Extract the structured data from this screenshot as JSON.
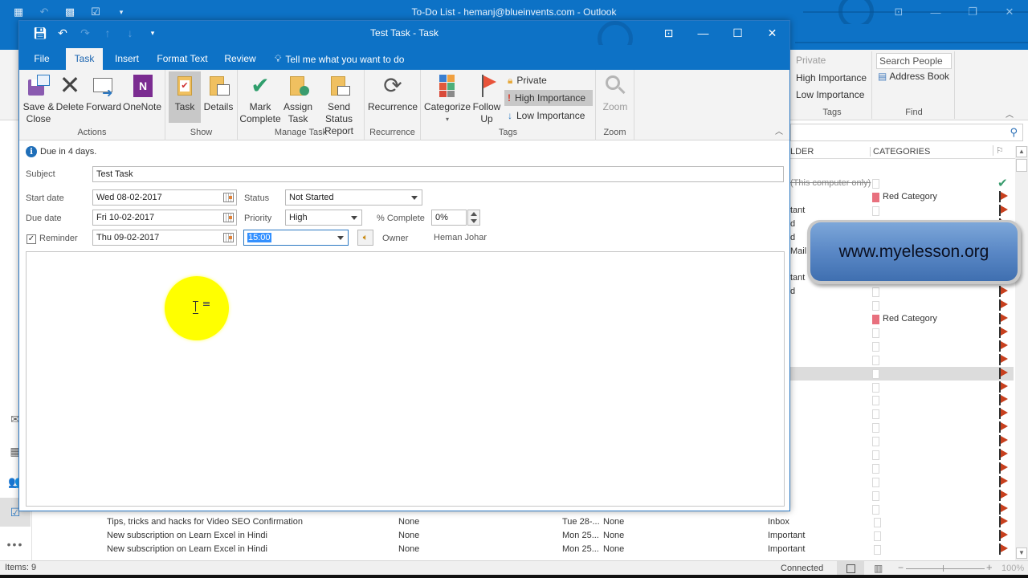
{
  "background_window": {
    "title": "To-Do List - hemanj@blueinvents.com  -  Outlook",
    "qat_icons": [
      "outlook-app-icon",
      "undo-icon",
      "address-book-icon",
      "task-icon",
      "customize-qat-icon"
    ],
    "window_controls": [
      "ribbon-display-icon",
      "minimize-icon",
      "restore-icon",
      "close-icon"
    ],
    "ribbon": {
      "tags": {
        "private": "Private",
        "high_importance": "High Importance",
        "low_importance": "Low Importance",
        "label": "Tags"
      },
      "find": {
        "search_people_placeholder": "Search People",
        "address_book": "Address Book",
        "label": "Find"
      }
    },
    "list": {
      "columns": {
        "folder": "LDER",
        "categories": "CATEGORIES"
      },
      "rows": [
        {
          "folder": "(This computer only)",
          "strike": true,
          "category": "",
          "flag": "complete"
        },
        {
          "folder": "",
          "category": "Red Category",
          "flag": "flag"
        },
        {
          "folder": "tant",
          "category": "",
          "flag": "flag"
        },
        {
          "folder": "d",
          "category": "",
          "flag": "flag"
        },
        {
          "folder": "d",
          "category": "",
          "flag": "flag"
        },
        {
          "folder": "Mail",
          "category": "",
          "flag": "flag"
        },
        {
          "folder": "",
          "category": "",
          "flag": "flag"
        },
        {
          "folder": "tant",
          "category": "",
          "flag": "flag"
        },
        {
          "folder": "d",
          "category": "",
          "flag": "flag"
        },
        {
          "folder": "",
          "category": "",
          "flag": "flag"
        },
        {
          "folder": "",
          "category": "Red Category",
          "flag": "flag"
        },
        {
          "folder": "",
          "category": "",
          "flag": "flag"
        },
        {
          "folder": "",
          "category": "",
          "flag": "flag"
        },
        {
          "folder": "",
          "category": "",
          "flag": "flag"
        },
        {
          "folder": "",
          "category": "",
          "flag": "flag",
          "selected": true
        },
        {
          "folder": "",
          "category": "",
          "flag": "flag"
        },
        {
          "folder": "",
          "category": "",
          "flag": "flag"
        },
        {
          "folder": "",
          "category": "",
          "flag": "flag"
        },
        {
          "folder": "",
          "category": "",
          "flag": "flag"
        },
        {
          "folder": "",
          "category": "",
          "flag": "flag"
        },
        {
          "folder": "",
          "category": "",
          "flag": "flag"
        },
        {
          "folder": "",
          "category": "",
          "flag": "flag"
        },
        {
          "folder": "",
          "category": "",
          "flag": "flag"
        },
        {
          "folder": "",
          "category": "",
          "flag": "flag"
        },
        {
          "folder": "",
          "category": "",
          "flag": "flag"
        }
      ],
      "bottom_rows": [
        {
          "subject": "Tips, tricks and hacks for Video SEO Confirmation",
          "reminder": "None",
          "due": "Tue 28-...",
          "start": "None",
          "folder": "Inbox"
        },
        {
          "subject": "New subscription on Learn Excel in Hindi",
          "reminder": "None",
          "due": "Mon 25...",
          "start": "None",
          "folder": "Important"
        },
        {
          "subject": "New subscription on Learn Excel in Hindi",
          "reminder": "None",
          "due": "Mon 25...",
          "start": "None",
          "folder": "Important"
        }
      ]
    },
    "statusbar": {
      "items": "Items: 9",
      "connection": "Connected",
      "zoom": "100%"
    }
  },
  "watermark": {
    "text": "www.myelesson.org"
  },
  "task_window": {
    "title": "Test Task  -  Task",
    "qat_icons": [
      "save-icon",
      "undo-icon",
      "redo-icon",
      "previous-item-icon",
      "next-item-icon",
      "customize-qat-icon"
    ],
    "tabs": [
      {
        "label": "File",
        "active": false
      },
      {
        "label": "Task",
        "active": true
      },
      {
        "label": "Insert",
        "active": false
      },
      {
        "label": "Format Text",
        "active": false
      },
      {
        "label": "Review",
        "active": false
      }
    ],
    "tell_me": "Tell me what you want to do",
    "ribbon": {
      "actions": {
        "label": "Actions",
        "save_close": [
          "Save &",
          "Close"
        ],
        "delete": "Delete",
        "forward": "Forward",
        "onenote": "OneNote"
      },
      "show": {
        "label": "Show",
        "task": "Task",
        "details": "Details"
      },
      "manage_task": {
        "label": "Manage Task",
        "mark_complete": [
          "Mark",
          "Complete"
        ],
        "assign_task": [
          "Assign",
          "Task"
        ],
        "send_status_report": [
          "Send Status",
          "Report"
        ]
      },
      "recurrence": {
        "label": "Recurrence",
        "recurrence": "Recurrence"
      },
      "tags": {
        "label": "Tags",
        "categorize": "Categorize",
        "follow_up": [
          "Follow",
          "Up"
        ],
        "private": "Private",
        "high_importance": "High Importance",
        "low_importance": "Low Importance"
      },
      "zoom": {
        "label": "Zoom",
        "zoom": "Zoom"
      }
    },
    "form": {
      "info": "Due in 4 days.",
      "subject_label": "Subject",
      "subject": "Test Task",
      "start_date_label": "Start date",
      "start_date": "Wed 08-02-2017",
      "due_date_label": "Due date",
      "due_date": "Fri 10-02-2017",
      "reminder_label": "Reminder",
      "reminder_checked": true,
      "reminder_date": "Thu 09-02-2017",
      "reminder_time": "15:00",
      "status_label": "Status",
      "status": "Not Started",
      "priority_label": "Priority",
      "priority": "High",
      "percent_label": "% Complete",
      "percent": "0%",
      "owner_label": "Owner",
      "owner": "Heman Johar",
      "body": ""
    }
  }
}
